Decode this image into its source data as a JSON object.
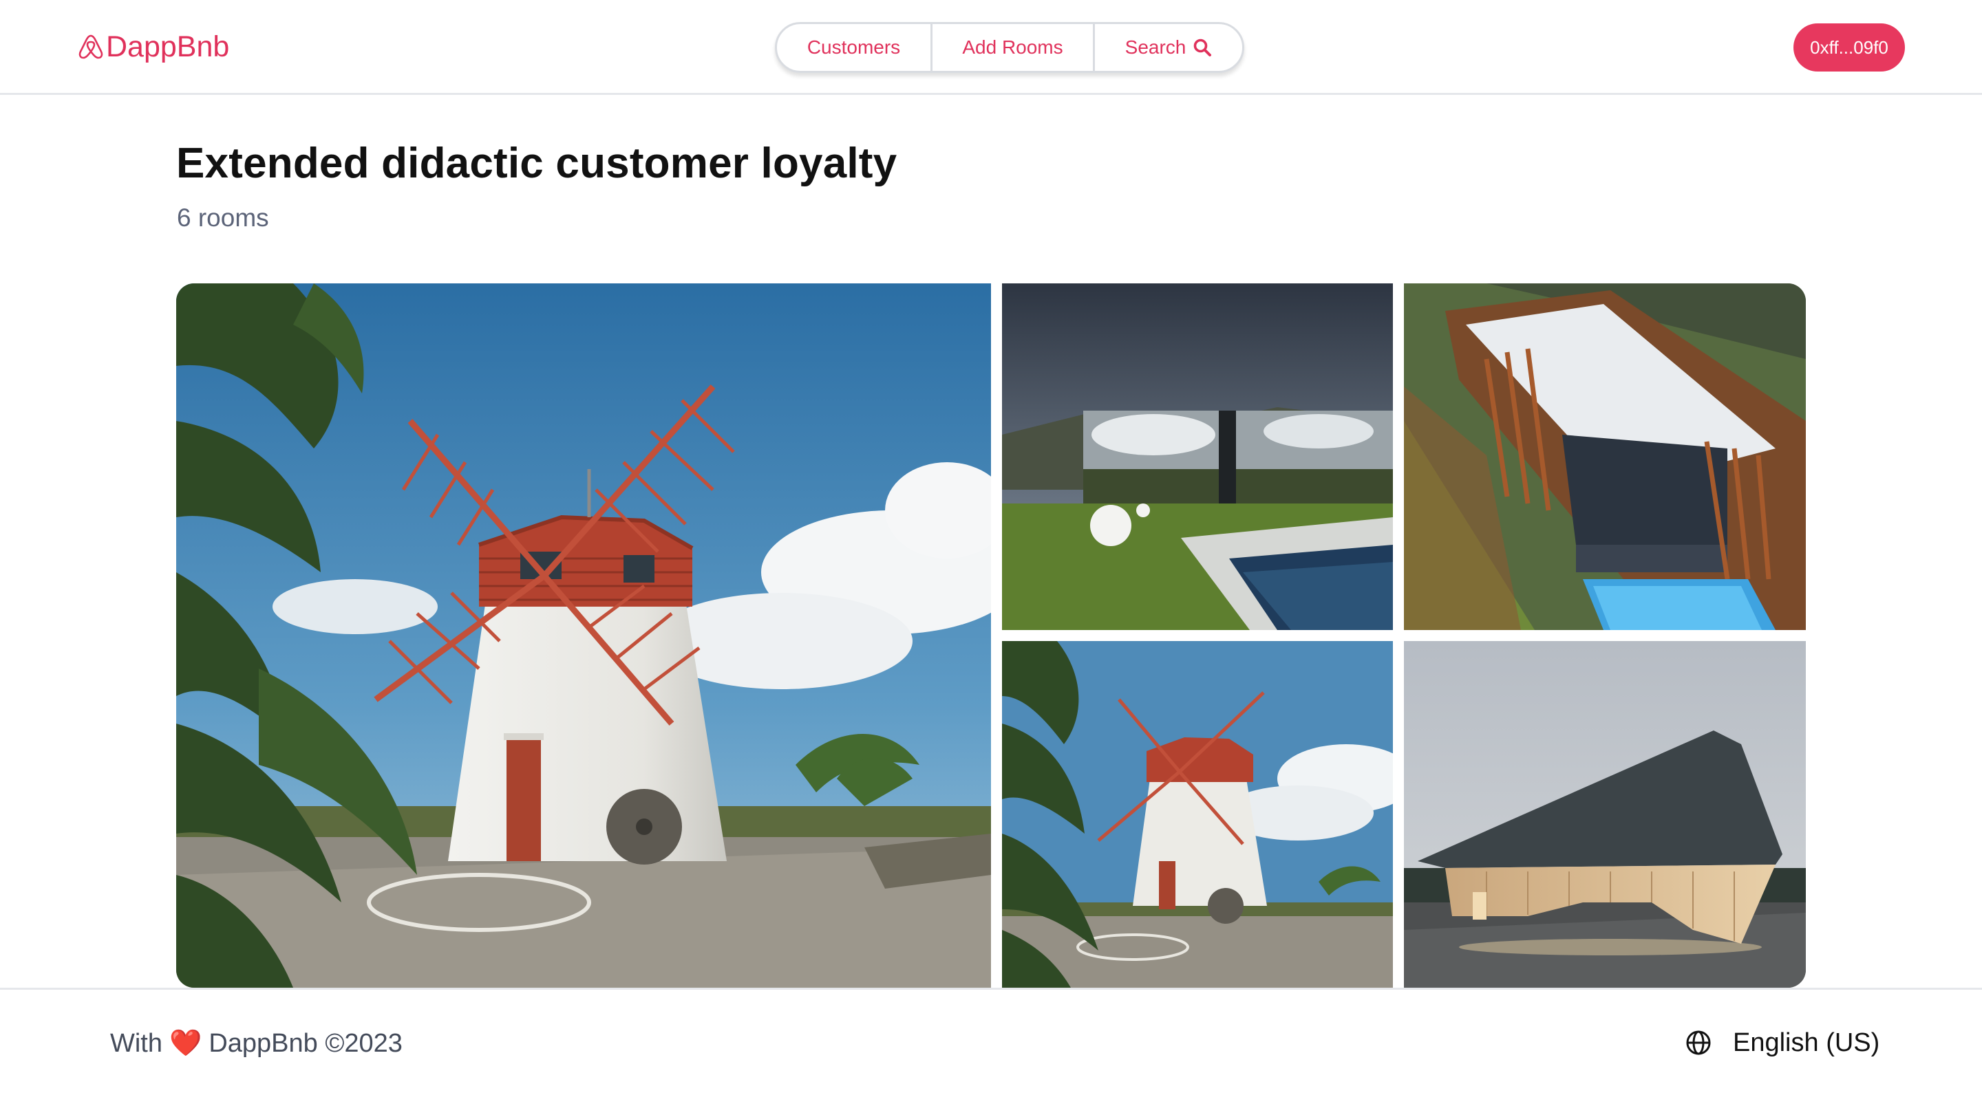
{
  "header": {
    "brand": "DappBnb",
    "nav": {
      "customers": "Customers",
      "add_rooms": "Add Rooms",
      "search": "Search"
    },
    "wallet": "0xff...09f0"
  },
  "main": {
    "title": "Extended didactic customer loyalty",
    "subtitle": "6 rooms",
    "photos": [
      {
        "subject": "white windmill with red sails"
      },
      {
        "subject": "mirrored house with pool"
      },
      {
        "subject": "wooden pergola house with pool"
      },
      {
        "subject": "white windmill with red sails"
      },
      {
        "subject": "concrete building with wooden underside at dusk"
      }
    ]
  },
  "footer": {
    "credit_prefix": "With",
    "credit_heart": "❤️",
    "credit_suffix": "DappBnb ©2023",
    "language": "English (US)"
  },
  "colors": {
    "brand": "#e0315b",
    "wallet_bg": "#e7385e",
    "subtitle": "#5b6378"
  }
}
